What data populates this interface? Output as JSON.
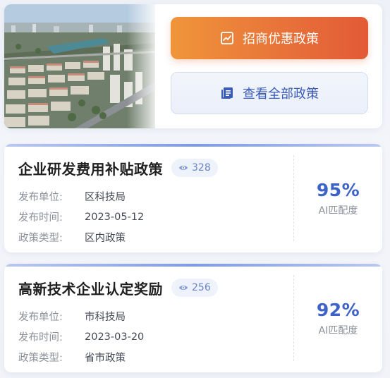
{
  "hero": {
    "primary_button_label": "招商优惠政策",
    "secondary_button_label": "查看全部政策",
    "primary_icon": "chart-line-icon",
    "secondary_icon": "document-list-icon"
  },
  "policies": [
    {
      "title": "企业研发费用补贴政策",
      "views": "328",
      "meta": [
        {
          "key": "发布单位:",
          "value": "区科技局"
        },
        {
          "key": "发布时间:",
          "value": "2023-05-12"
        },
        {
          "key": "政策类型:",
          "value": "区内政策"
        }
      ],
      "match_value": "95%",
      "match_label": "AI匹配度"
    },
    {
      "title": "高新技术企业认定奖励",
      "views": "256",
      "meta": [
        {
          "key": "发布单位:",
          "value": "市科技局"
        },
        {
          "key": "发布时间:",
          "value": "2023-03-20"
        },
        {
          "key": "政策类型:",
          "value": "省市政策"
        }
      ],
      "match_value": "92%",
      "match_label": "AI匹配度"
    }
  ],
  "colors": {
    "accent_orange": "#e8743a",
    "accent_blue": "#3d63c8"
  }
}
